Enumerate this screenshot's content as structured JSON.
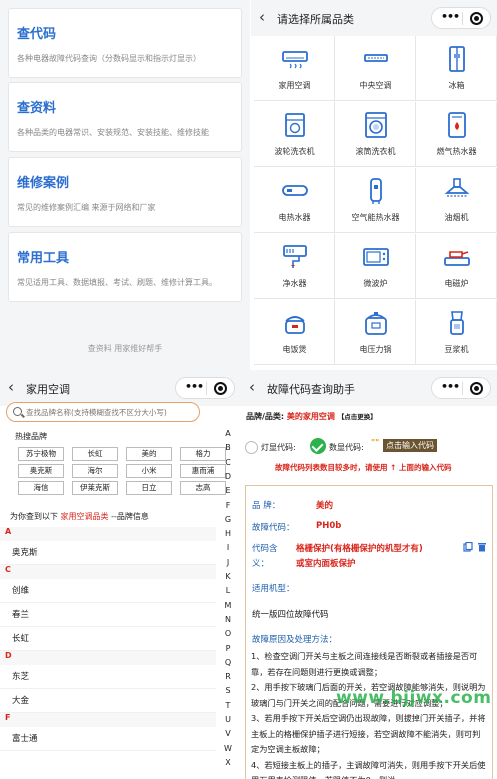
{
  "menu": {
    "cards": [
      {
        "title": "查代码",
        "desc": "各种电器故障代码查询（分数码显示和指示灯显示）"
      },
      {
        "title": "查资料",
        "desc": "各种品类的电器常识、安装规范、安装技能、维修技能"
      },
      {
        "title": "维修案例",
        "desc": "常见的维修案例汇编 来源于网络和厂家"
      },
      {
        "title": "常用工具",
        "desc": "常见适用工具、数据填报、考试、刷题、维修计算工具。"
      }
    ],
    "footer": "查资料 用家维好帮手"
  },
  "category": {
    "title": "请选择所属品类",
    "items": [
      {
        "label": "家用空调",
        "icon": "wall-ac-icon"
      },
      {
        "label": "中央空调",
        "icon": "central-ac-icon"
      },
      {
        "label": "冰箱",
        "icon": "fridge-icon"
      },
      {
        "label": "波轮洗衣机",
        "icon": "top-load-washer-icon"
      },
      {
        "label": "滚筒洗衣机",
        "icon": "front-load-washer-icon"
      },
      {
        "label": "燃气热水器",
        "icon": "gas-heater-icon"
      },
      {
        "label": "电热水器",
        "icon": "electric-heater-icon"
      },
      {
        "label": "空气能热水器",
        "icon": "air-heater-icon"
      },
      {
        "label": "油烟机",
        "icon": "range-hood-icon"
      },
      {
        "label": "净水器",
        "icon": "water-purifier-icon"
      },
      {
        "label": "微波炉",
        "icon": "microwave-icon"
      },
      {
        "label": "电磁炉",
        "icon": "induction-cooker-icon"
      },
      {
        "label": "电饭煲",
        "icon": "rice-cooker-icon"
      },
      {
        "label": "电压力锅",
        "icon": "pressure-cooker-icon"
      },
      {
        "label": "豆浆机",
        "icon": "soymilk-maker-icon"
      }
    ]
  },
  "brands": {
    "title": "家用空调",
    "search_placeholder": "查找品牌名称(支持模糊查找不区分大小写)",
    "hot_title": "热搜品牌",
    "hot": [
      "苏宁极物",
      "长虹",
      "美的",
      "格力",
      "奥克斯",
      "海尔",
      "小米",
      "惠而浦",
      "海信",
      "伊莱克斯",
      "日立",
      "志高"
    ],
    "found_prefix": "为你查到以下",
    "found_highlight": "家用空调品类",
    "found_suffix": "--品牌信息",
    "sections": [
      {
        "letter": "A",
        "rows": [
          "奥克斯"
        ]
      },
      {
        "letter": "C",
        "rows": [
          "创维",
          "春兰",
          "长虹"
        ]
      },
      {
        "letter": "D",
        "rows": [
          "东芝",
          "大金"
        ]
      },
      {
        "letter": "F",
        "rows": [
          "富士通"
        ]
      }
    ],
    "index": [
      "A",
      "B",
      "C",
      "D",
      "E",
      "F",
      "G",
      "H",
      "I",
      "J",
      "K",
      "L",
      "M",
      "N",
      "O",
      "P",
      "Q",
      "R",
      "S",
      "T",
      "U",
      "V",
      "W",
      "X"
    ]
  },
  "fault": {
    "title": "故障代码查询助手",
    "brand_line_label": "品牌/品类:",
    "brand_line_value": "美的家用空调",
    "brand_line_tag": "【点击更换】",
    "mode_light": "灯显代码:",
    "mode_digital": "数显代码:",
    "quote_mark": "\"\"",
    "input_button": "点击输入代码",
    "notice": "故障代码列表数目较多时，请使用 ↑ 上面的输入代码",
    "brand_label": "品 牌：",
    "brand_value": "美的",
    "code_label": "故障代码：",
    "code_value": "PH0b",
    "meaning_label_1": "代码含",
    "meaning_label_2": "义：",
    "meaning_value_1": "格栅保护(有格栅保护的机型才有)",
    "meaning_value_2": "或室内面板保护",
    "model_label": "适用机型：",
    "model_value": "统一版四位故障代码",
    "cause_label": "故障原因及处理方法：",
    "causes": [
      "1、检查空调门开关与主板之间连接线是否断裂或者插接是否可靠，若存在问题则进行更换或调整；",
      "2、用手按下玻璃门后面的开关，若空调故障能够消失，则说明为玻璃门与门开关之间的配合问题，需要进行对应调整；",
      "3、若用手按下开关后空调仍出现故障，则拔掉门开关插子，并将主板上的格栅保护插子进行短接，若空调故障不能消失，则可判定为空调主板故障；",
      "4、若短接主板上的插子，主调故障可消失，则用手按下开关后使用万用表检测阻值，若阻值不为0，则说"
    ]
  },
  "watermark": "www.bjjwx.com",
  "colors": {
    "accent_blue": "#2c6fcf",
    "accent_red": "#d9261c",
    "watermark_green": "#2bb24c"
  }
}
